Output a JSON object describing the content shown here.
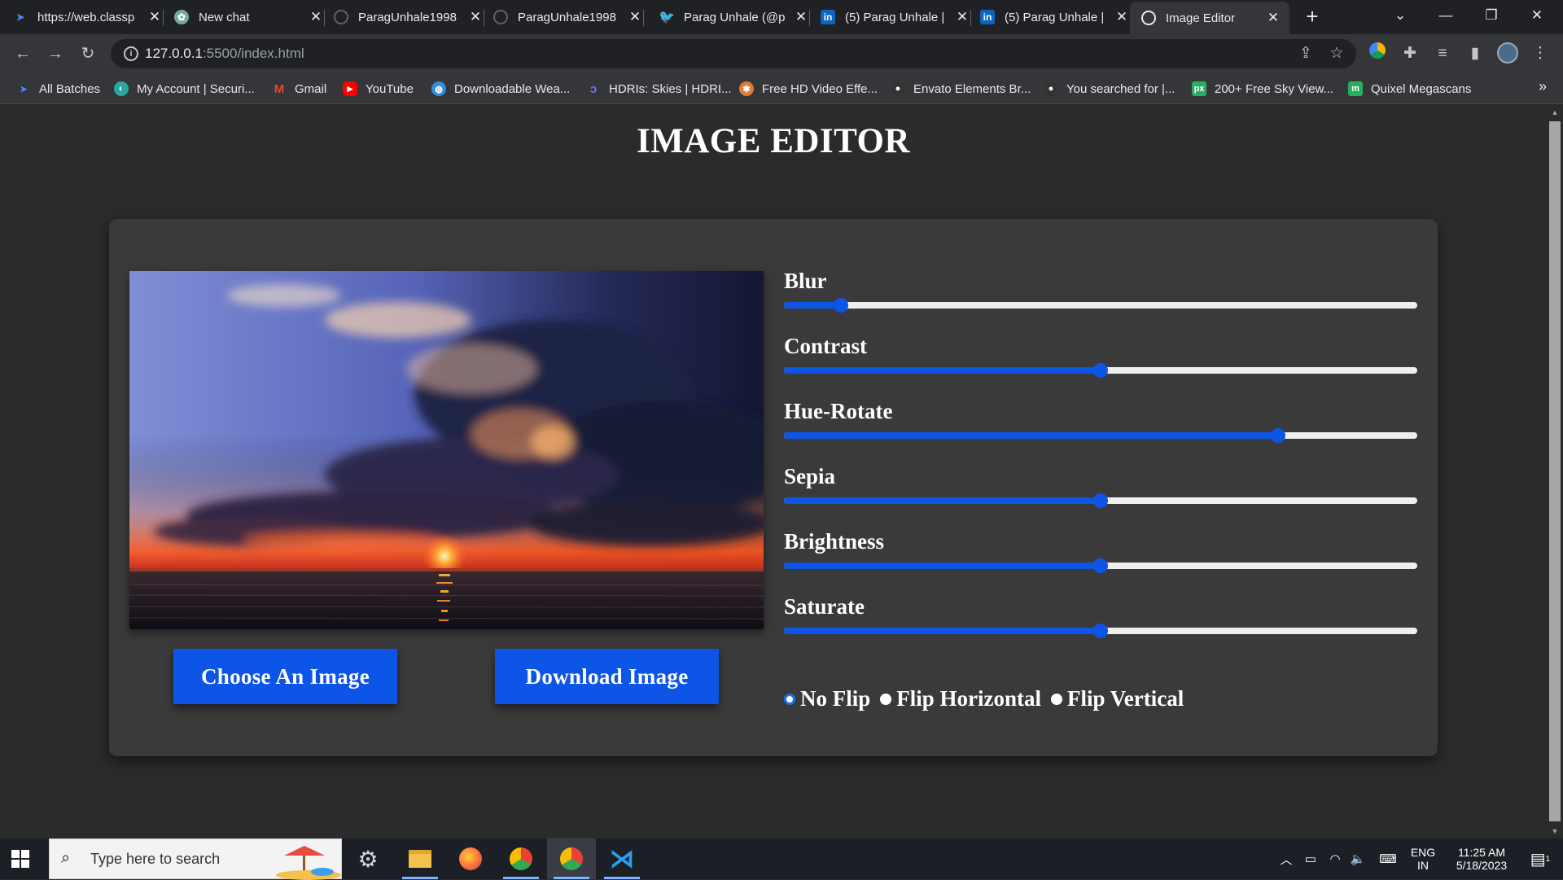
{
  "browser": {
    "tabs": [
      {
        "title": "https://web.classp",
        "favicon": "arrow-icon",
        "color": "#4c8bf5"
      },
      {
        "title": "New chat",
        "favicon": "chatgpt-icon",
        "color": "#74aa9c"
      },
      {
        "title": "ParagUnhale1998",
        "favicon": "github-icon",
        "color": "#5f6368"
      },
      {
        "title": "ParagUnhale1998",
        "favicon": "github-icon",
        "color": "#5f6368"
      },
      {
        "title": "Parag Unhale (@p",
        "favicon": "twitter-icon",
        "color": "#1d9bf0"
      },
      {
        "title": "(5) Parag Unhale |",
        "favicon": "linkedin-icon",
        "color": "#0a66c2"
      },
      {
        "title": "(5) Parag Unhale |",
        "favicon": "linkedin-icon",
        "color": "#0a66c2"
      },
      {
        "title": "Image Editor",
        "favicon": "globe-icon",
        "color": "#e8eaed"
      }
    ],
    "address": {
      "host": "127.0.0.1",
      "path": ":5500/index.html"
    },
    "bookmarks": [
      {
        "label": "All Batches",
        "icon": "arrow-icon",
        "color": "#4c8bf5"
      },
      {
        "label": "My Account | Securi...",
        "icon": "shield-icon",
        "color": "#2aa7a0"
      },
      {
        "label": "Gmail",
        "icon": "gmail-icon",
        "color": "#ea4335"
      },
      {
        "label": "YouTube",
        "icon": "youtube-icon",
        "color": "#ff0000"
      },
      {
        "label": "Downloadable Wea...",
        "icon": "globe-icon",
        "color": "#2f8ee0"
      },
      {
        "label": "HDRIs: Skies | HDRI...",
        "icon": "hdri-icon",
        "color": "#7b6ee8"
      },
      {
        "label": "Free HD Video Effe...",
        "icon": "film-icon",
        "color": "#e07b39"
      },
      {
        "label": "Envato Elements Br...",
        "icon": "envato-icon",
        "color": "#333333"
      },
      {
        "label": "You searched for |...",
        "icon": "envato-icon",
        "color": "#333333"
      },
      {
        "label": "200+ Free Sky View...",
        "icon": "px-icon",
        "color": "#27ae60"
      },
      {
        "label": "Quixel Megascans",
        "icon": "quixel-icon",
        "color": "#27ae60"
      }
    ]
  },
  "app": {
    "title": "IMAGE EDITOR",
    "controls": [
      {
        "label": "Blur",
        "value": 0.09
      },
      {
        "label": "Contrast",
        "value": 0.5
      },
      {
        "label": "Hue-Rotate",
        "value": 0.78
      },
      {
        "label": "Sepia",
        "value": 0.5
      },
      {
        "label": "Brightness",
        "value": 0.5
      },
      {
        "label": "Saturate",
        "value": 0.5
      }
    ],
    "choose_button": "Choose An Image",
    "download_button": "Download Image",
    "flip_options": [
      {
        "label": "No Flip",
        "checked": true
      },
      {
        "label": "Flip Horizontal",
        "checked": false
      },
      {
        "label": "Flip Vertical",
        "checked": false
      }
    ],
    "accent_color": "#0d55e6"
  },
  "taskbar": {
    "search_placeholder": "Type here to search",
    "language": "ENG",
    "region": "IN",
    "time": "11:25 AM",
    "date": "5/18/2023",
    "notification_count": "1"
  }
}
